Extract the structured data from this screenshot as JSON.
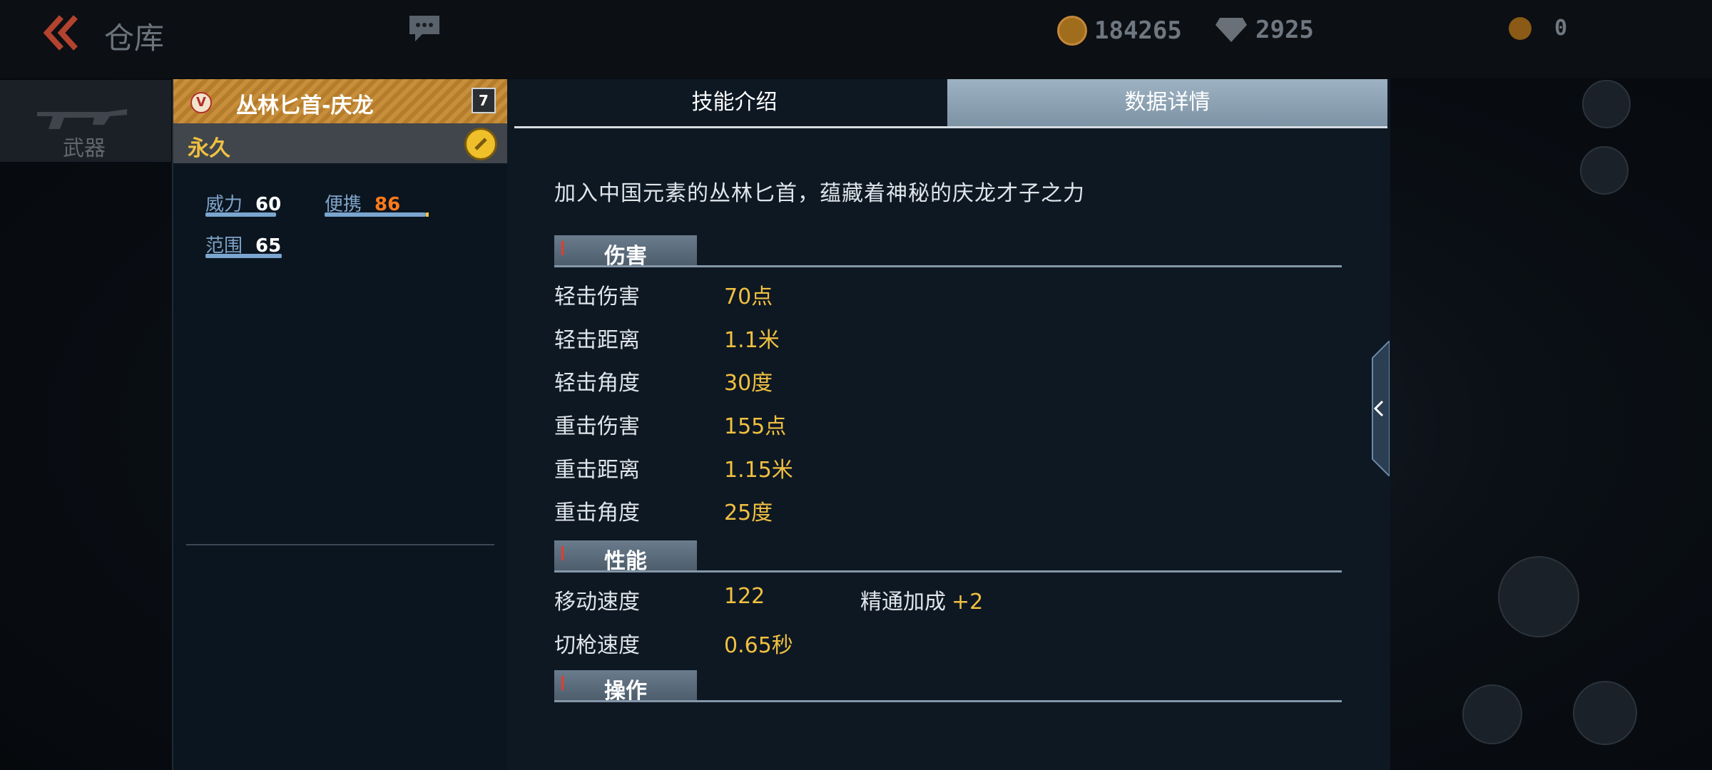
{
  "header": {
    "title": "仓库",
    "gold": "184265",
    "diamonds": "2925",
    "tokens": "0"
  },
  "sidebar": {
    "active_item": "武器"
  },
  "weapon": {
    "name": "丛林匕首-庆龙",
    "rank_badge": "V",
    "level": "7",
    "duration": "永久",
    "stats": [
      {
        "label": "威力",
        "value": "60",
        "ratio": 0.6
      },
      {
        "label": "便携",
        "value": "86",
        "ratio": 0.86
      },
      {
        "label": "范围",
        "value": "65",
        "ratio": 0.65
      }
    ]
  },
  "tabs": {
    "skill": "技能介绍",
    "data": "数据详情",
    "active": "data"
  },
  "details": {
    "description": "加入中国元素的丛林匕首，蕴藏着神秘的庆龙才子之力",
    "sections": {
      "damage": {
        "title": "伤害",
        "rows": [
          {
            "label": "轻击伤害",
            "value": "70点"
          },
          {
            "label": "轻击距离",
            "value": "1.1米"
          },
          {
            "label": "轻击角度",
            "value": "30度"
          },
          {
            "label": "重击伤害",
            "value": "155点"
          },
          {
            "label": "重击距离",
            "value": "1.15米"
          },
          {
            "label": "重击角度",
            "value": "25度"
          }
        ]
      },
      "performance": {
        "title": "性能",
        "rows": [
          {
            "label": "移动速度",
            "value": "122"
          },
          {
            "label": "切枪速度",
            "value": "0.65秒"
          }
        ],
        "mastery_label": "精通加成",
        "mastery_value": "+2"
      },
      "operation": {
        "title": "操作"
      }
    }
  },
  "colors": {
    "accent_gold": "#f0c040",
    "portable_orange": "#ff7a1a",
    "stat_bar_blue": "#7aa6cf",
    "section_mark_red": "#e83a2c"
  },
  "icons": {
    "back": "double-chevron-left-icon",
    "chat": "chat-bubble-icon",
    "gold": "gold-coin-icon",
    "diamond": "diamond-icon",
    "duration": "permanent-badge-icon",
    "collapse": "chevron-left-icon"
  }
}
